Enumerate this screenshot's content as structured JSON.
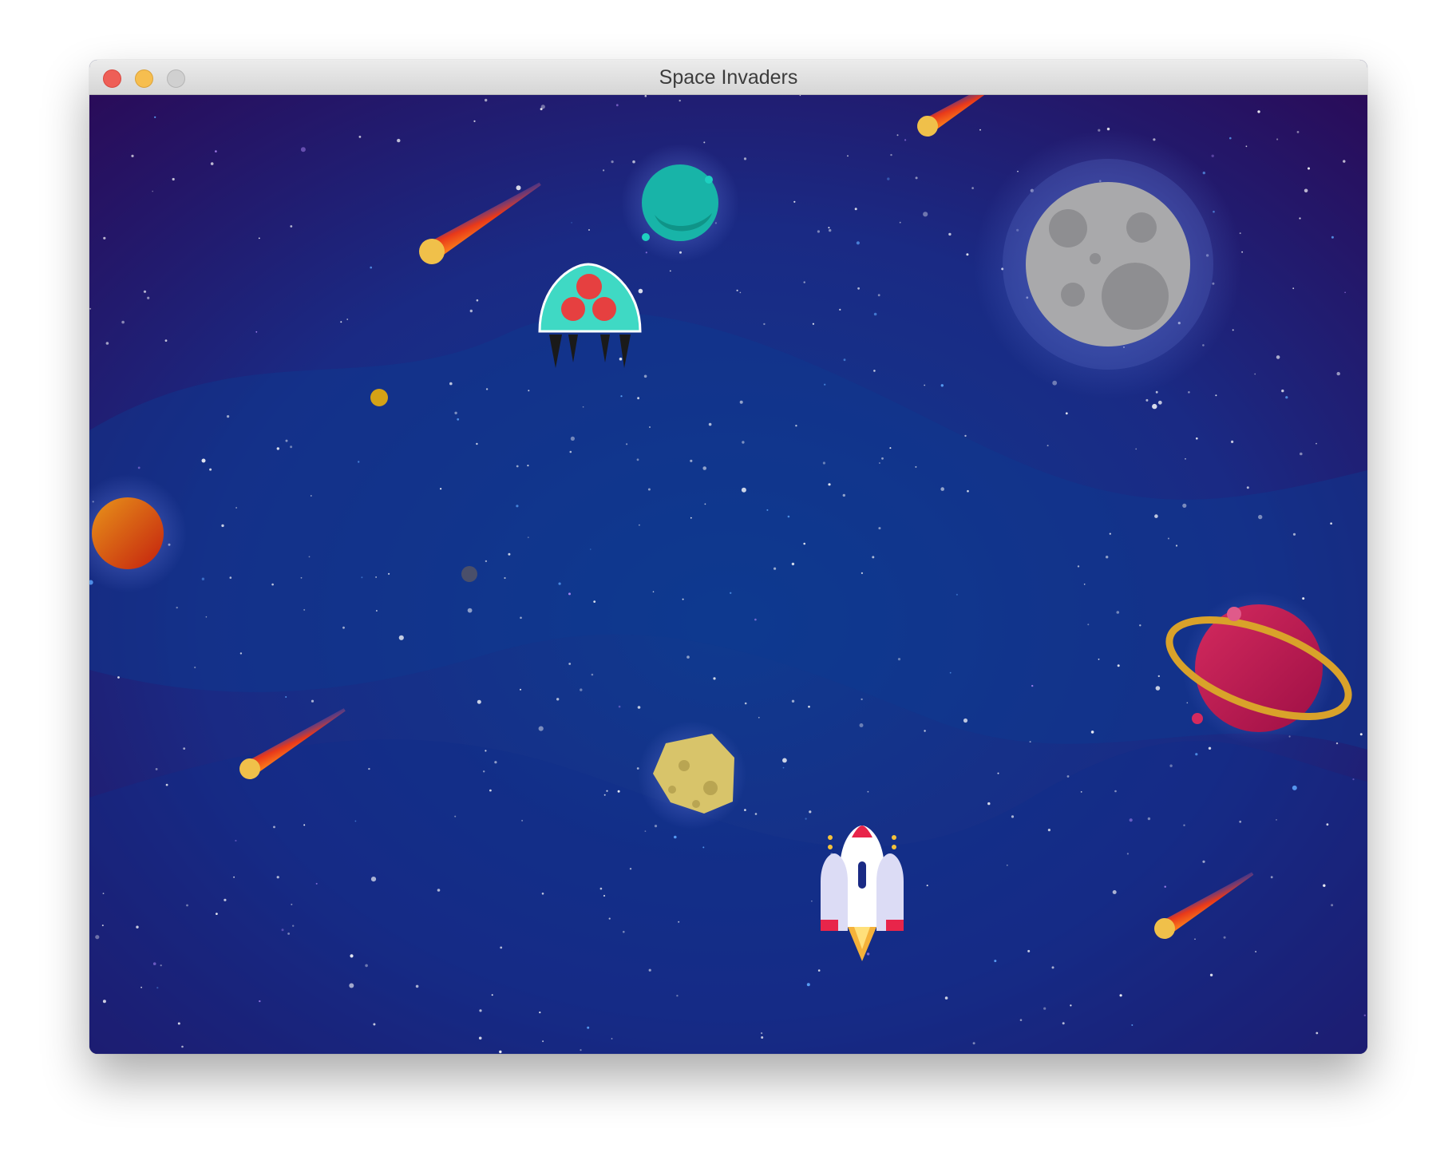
{
  "window": {
    "title": "Space Invaders",
    "controls": [
      "close",
      "minimize",
      "zoom"
    ]
  },
  "scene": {
    "background": "starfield",
    "colors": {
      "sky_center": "#123a8c",
      "sky_edge": "#2a0b55",
      "player": "#ffffff",
      "invader": "#3fd9c4",
      "invader_spots": "#e64040"
    },
    "player_icon": "rocket-ship-icon",
    "enemy_icon": "jellyfish-invader-icon",
    "decor_icons": [
      "moon-icon",
      "teal-planet-icon",
      "orange-planet-icon",
      "ringed-planet-icon",
      "asteroid-icon",
      "comet-icon"
    ]
  }
}
